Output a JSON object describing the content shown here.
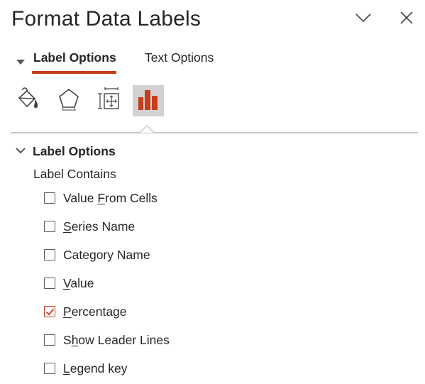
{
  "pane": {
    "title": "Format Data Labels"
  },
  "tabs": [
    {
      "label": "Label Options",
      "active": true
    },
    {
      "label": "Text Options",
      "active": false
    }
  ],
  "toolbar_icons": [
    {
      "icon": "fill-line-icon",
      "selected": false
    },
    {
      "icon": "effects-pentagon-icon",
      "selected": false
    },
    {
      "icon": "size-properties-icon",
      "selected": false
    },
    {
      "icon": "label-options-bar-chart-icon",
      "selected": true
    }
  ],
  "section": {
    "title": "Label Options",
    "expanded": true,
    "group_label": "Label Contains",
    "options": [
      {
        "pre": "Value ",
        "key": "F",
        "post": "rom Cells",
        "checked": false
      },
      {
        "pre": "",
        "key": "S",
        "post": "eries Name",
        "checked": false
      },
      {
        "pre": "Cate",
        "key": "g",
        "post": "ory Name",
        "checked": false
      },
      {
        "pre": "",
        "key": "V",
        "post": "alue",
        "checked": false
      },
      {
        "pre": "",
        "key": "P",
        "post": "ercentage",
        "checked": true
      },
      {
        "pre": "S",
        "key": "h",
        "post": "ow Leader Lines",
        "checked": false
      },
      {
        "pre": "",
        "key": "L",
        "post": "egend key",
        "checked": false
      }
    ]
  },
  "colors": {
    "accent": "#c43e1c",
    "text": "#262626",
    "selected_icon_bg": "#d2d2d2"
  }
}
